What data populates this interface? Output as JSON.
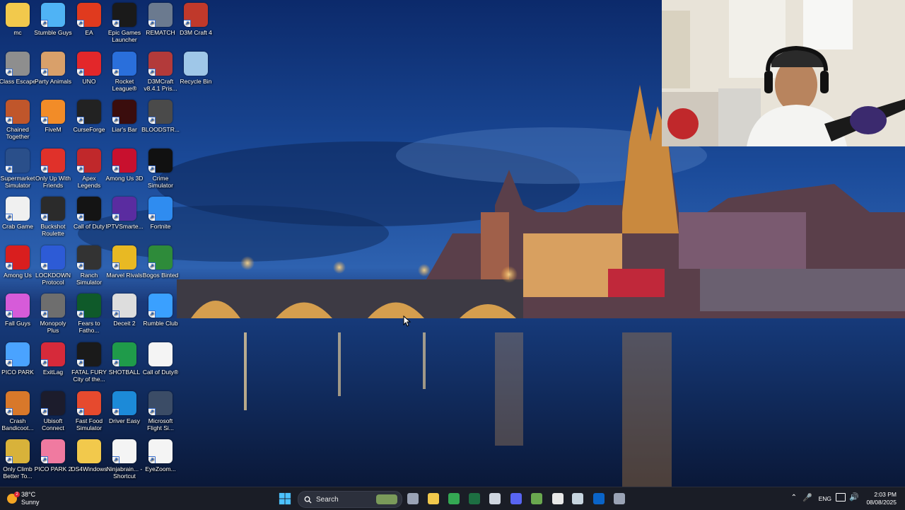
{
  "desktop": {
    "icons": [
      {
        "label": "mc",
        "icon": "folder-icon",
        "color": "#f2c94c"
      },
      {
        "label": "Stumble Guys",
        "icon": "stumble-guys-icon",
        "color": "#4fb3f5"
      },
      {
        "label": "EA",
        "icon": "ea-icon",
        "color": "#e03a1e"
      },
      {
        "label": "Epic Games Launcher",
        "icon": "epic-games-icon",
        "color": "#1a1a1a"
      },
      {
        "label": "REMATCH",
        "icon": "rematch-icon",
        "color": "#6b7a8f"
      },
      {
        "label": "D3M Craft 4",
        "icon": "d3m-craft-icon",
        "color": "#c0392b"
      },
      {
        "label": "Class Escape",
        "icon": "class-escape-icon",
        "color": "#8e8e8e"
      },
      {
        "label": "Party Animals",
        "icon": "party-animals-icon",
        "color": "#d9a06a"
      },
      {
        "label": "UNO",
        "icon": "uno-icon",
        "color": "#e3272a"
      },
      {
        "label": "Rocket League®",
        "icon": "rocket-league-icon",
        "color": "#2a6fdb"
      },
      {
        "label": "D3MCraft v8.4.1 Pris...",
        "icon": "d3mcraft-icon",
        "color": "#b33a3a"
      },
      {
        "label": "Recycle Bin",
        "icon": "recycle-bin-icon",
        "color": "#9fc7e8"
      },
      {
        "label": "Chained Together",
        "icon": "chained-together-icon",
        "color": "#c0562b"
      },
      {
        "label": "FiveM",
        "icon": "fivem-icon",
        "color": "#f28c28"
      },
      {
        "label": "CurseForge",
        "icon": "curseforge-icon",
        "color": "#222222"
      },
      {
        "label": "Liar's Bar",
        "icon": "liars-bar-icon",
        "color": "#3a0d0d"
      },
      {
        "label": "BLOODSTR...",
        "icon": "bloodstrike-icon",
        "color": "#4a4a4a"
      },
      {
        "label": "Supermarket Simulator",
        "icon": "supermarket-simulator-icon",
        "color": "#2a4f8a"
      },
      {
        "label": "Only Up With Friends",
        "icon": "only-up-icon",
        "color": "#e0312a"
      },
      {
        "label": "Apex Legends",
        "icon": "apex-legends-icon",
        "color": "#c0282b"
      },
      {
        "label": "Among Us 3D",
        "icon": "among-us-3d-icon",
        "color": "#c8102e"
      },
      {
        "label": "Crime Simulator",
        "icon": "crime-simulator-icon",
        "color": "#111111"
      },
      {
        "label": "Crab Game",
        "icon": "crab-game-icon",
        "color": "#f0f0f0"
      },
      {
        "label": "Buckshot Roulette",
        "icon": "buckshot-roulette-icon",
        "color": "#2b2b2b"
      },
      {
        "label": "Call of Duty",
        "icon": "call-of-duty-icon",
        "color": "#141414"
      },
      {
        "label": "IPTVSmarte...",
        "icon": "iptv-smarters-icon",
        "color": "#5a2ca0"
      },
      {
        "label": "Fortnite",
        "icon": "fortnite-icon",
        "color": "#2f8cf0"
      },
      {
        "label": "Among Us",
        "icon": "among-us-icon",
        "color": "#d91e1e"
      },
      {
        "label": "LOCKDOWN Protocol",
        "icon": "lockdown-protocol-icon",
        "color": "#2d5bd6"
      },
      {
        "label": "Ranch Simulator",
        "icon": "ranch-simulator-icon",
        "color": "#333333"
      },
      {
        "label": "Marvel Rivals",
        "icon": "marvel-rivals-icon",
        "color": "#e8b923"
      },
      {
        "label": "Bogos Binted",
        "icon": "bogos-binted-icon",
        "color": "#2e8b3a"
      },
      {
        "label": "Fall Guys",
        "icon": "fall-guys-icon",
        "color": "#d65bd9"
      },
      {
        "label": "Monopoly Plus",
        "icon": "monopoly-plus-icon",
        "color": "#6e6e6e"
      },
      {
        "label": "Fears to Fatho...",
        "icon": "fears-to-fathom-icon",
        "color": "#0f5a2a"
      },
      {
        "label": "Deceit 2",
        "icon": "deceit-2-icon",
        "color": "#dddddd"
      },
      {
        "label": "Rumble Club",
        "icon": "rumble-club-icon",
        "color": "#3aa0ff"
      },
      {
        "label": "PICO PARK",
        "icon": "pico-park-icon",
        "color": "#4aa3ff"
      },
      {
        "label": "ExitLag",
        "icon": "exitlag-icon",
        "color": "#d62a3a"
      },
      {
        "label": "FATAL FURY City of the...",
        "icon": "fatal-fury-icon",
        "color": "#1a1a1a"
      },
      {
        "label": "SHOTBALL",
        "icon": "shotball-icon",
        "color": "#1f9b4a"
      },
      {
        "label": "Call of Duty®",
        "icon": "blank-file-icon",
        "color": "#f4f4f4"
      },
      {
        "label": "Crash Bandicoot...",
        "icon": "crash-bandicoot-icon",
        "color": "#d8782a"
      },
      {
        "label": "Ubisoft Connect",
        "icon": "ubisoft-connect-icon",
        "color": "#1c1c2c"
      },
      {
        "label": "Fast Food Simulator",
        "icon": "fast-food-simulator-icon",
        "color": "#e64a2e"
      },
      {
        "label": "Driver Easy",
        "icon": "driver-easy-icon",
        "color": "#1c8ad8"
      },
      {
        "label": "Microsoft Flight Si...",
        "icon": "flight-simulator-icon",
        "color": "#3b4c66"
      },
      {
        "label": "Only Climb Better To...",
        "icon": "only-climb-icon",
        "color": "#d8b23a"
      },
      {
        "label": "PICO PARK 2",
        "icon": "pico-park-2-icon",
        "color": "#f07aa0"
      },
      {
        "label": "DS4Windows",
        "icon": "folder-icon",
        "color": "#f2c94c"
      },
      {
        "label": "Ninjabrain... - Shortcut",
        "icon": "java-icon",
        "color": "#f4f4f4"
      },
      {
        "label": "EyeZoom...",
        "icon": "eyezoom-icon",
        "color": "#f4f4f4"
      }
    ]
  },
  "taskbar": {
    "weather": {
      "temp": "38°C",
      "condition": "Sunny",
      "badge": "2"
    },
    "search_label": "Search",
    "apps": [
      {
        "icon": "task-view-icon",
        "color": "#9aa3b5"
      },
      {
        "icon": "file-explorer-icon",
        "color": "#f2c94c"
      },
      {
        "icon": "chrome-icon",
        "color": "#34a853"
      },
      {
        "icon": "excel-icon",
        "color": "#1d6f42"
      },
      {
        "icon": "steam-alt-icon",
        "color": "#cfd6e0"
      },
      {
        "icon": "discord-icon",
        "color": "#5865f2"
      },
      {
        "icon": "minecraft-icon",
        "color": "#6aa84f"
      },
      {
        "icon": "capcut-icon",
        "color": "#e8e8e8"
      },
      {
        "icon": "steam-icon",
        "color": "#c7d5e0"
      },
      {
        "icon": "outlook-icon",
        "color": "#0a64c8"
      },
      {
        "icon": "terminal-icon",
        "color": "#9aa3b5"
      }
    ],
    "lang": "ENG",
    "time": "2:03 PM",
    "date": "08/08/2025"
  },
  "colors": {
    "accent": "#3aa0ff",
    "taskbar": "#1a1d26"
  }
}
